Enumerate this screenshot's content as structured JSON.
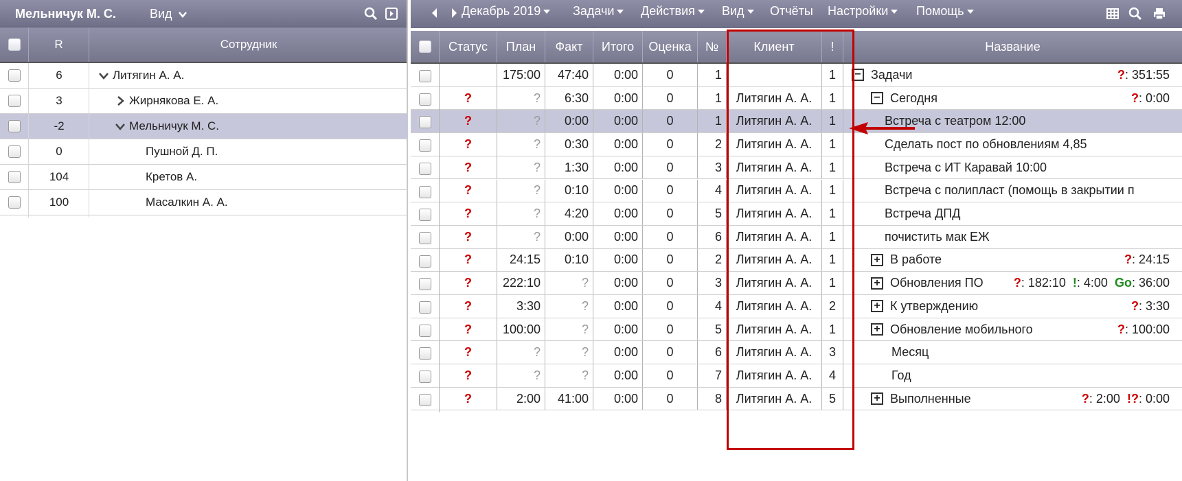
{
  "left_panel": {
    "title": "Мельничук М. С.",
    "view_menu": "Вид",
    "columns": {
      "r": "R",
      "employee": "Сотрудник"
    },
    "rows": [
      {
        "r": "6",
        "name": "Литягин А. А.",
        "indent": 0,
        "toggle": "expanded",
        "selected": false
      },
      {
        "r": "3",
        "name": "Жирнякова Е. А.",
        "indent": 1,
        "toggle": "collapsed",
        "selected": false
      },
      {
        "r": "-2",
        "name": "Мельничук М. С.",
        "indent": 1,
        "toggle": "expanded",
        "selected": true
      },
      {
        "r": "0",
        "name": "Пушной Д. П.",
        "indent": 2,
        "toggle": "none",
        "selected": false
      },
      {
        "r": "104",
        "name": "Кретов А.",
        "indent": 2,
        "toggle": "none",
        "selected": false
      },
      {
        "r": "100",
        "name": "Масалкин А. А.",
        "indent": 2,
        "toggle": "none",
        "selected": false
      }
    ]
  },
  "toolbar": {
    "period": "Декабрь 2019",
    "menus": [
      "Задачи",
      "Действия",
      "Вид",
      "Отчёты",
      "Настройки",
      "Помощь"
    ]
  },
  "table": {
    "columns": {
      "status": "Статус",
      "plan": "План",
      "fact": "Факт",
      "total": "Итого",
      "rating": "Оценка",
      "no": "№",
      "client": "Клиент",
      "priority": "!",
      "name": "Название"
    },
    "rows": [
      {
        "status": "",
        "plan": "175:00",
        "fact": "47:40",
        "total": "0:00",
        "rating": "0",
        "no": "1",
        "client": "",
        "priority": "1",
        "name": "Задачи",
        "level": 0,
        "toggle": "minus",
        "summary": [
          {
            "t": "?",
            "c": "red"
          },
          {
            "t": ": 351:55",
            "c": ""
          }
        ],
        "selected": false
      },
      {
        "status": "?",
        "plan": "?",
        "fact": "6:30",
        "total": "0:00",
        "rating": "0",
        "no": "1",
        "client": "Литягин А. А.",
        "priority": "1",
        "name": "Сегодня",
        "level": 1,
        "toggle": "minus",
        "summary": [
          {
            "t": "?",
            "c": "red"
          },
          {
            "t": ": 0:00",
            "c": ""
          }
        ],
        "selected": false
      },
      {
        "status": "?",
        "plan": "?",
        "fact": "0:00",
        "total": "0:00",
        "rating": "0",
        "no": "1",
        "client": "Литягин А. А.",
        "priority": "1",
        "name": "Встреча с театром 12:00",
        "level": 2,
        "toggle": "none",
        "summary": [],
        "selected": true
      },
      {
        "status": "?",
        "plan": "?",
        "fact": "0:30",
        "total": "0:00",
        "rating": "0",
        "no": "2",
        "client": "Литягин А. А.",
        "priority": "1",
        "name": "Сделать пост по обновлениям 4,85",
        "level": 2,
        "toggle": "none",
        "summary": [],
        "selected": false
      },
      {
        "status": "?",
        "plan": "?",
        "fact": "1:30",
        "total": "0:00",
        "rating": "0",
        "no": "3",
        "client": "Литягин А. А.",
        "priority": "1",
        "name": "Встреча с ИТ Каравай 10:00",
        "level": 2,
        "toggle": "none",
        "summary": [],
        "selected": false
      },
      {
        "status": "?",
        "plan": "?",
        "fact": "0:10",
        "total": "0:00",
        "rating": "0",
        "no": "4",
        "client": "Литягин А. А.",
        "priority": "1",
        "name": "Встреча с полипласт (помощь в закрытии п",
        "level": 2,
        "toggle": "none",
        "summary": [],
        "selected": false
      },
      {
        "status": "?",
        "plan": "?",
        "fact": "4:20",
        "total": "0:00",
        "rating": "0",
        "no": "5",
        "client": "Литягин А. А.",
        "priority": "1",
        "name": "Встреча ДПД",
        "level": 2,
        "toggle": "none",
        "summary": [],
        "selected": false
      },
      {
        "status": "?",
        "plan": "?",
        "fact": "0:00",
        "total": "0:00",
        "rating": "0",
        "no": "6",
        "client": "Литягин А. А.",
        "priority": "1",
        "name": "почистить мак ЕЖ",
        "level": 2,
        "toggle": "none",
        "summary": [],
        "selected": false
      },
      {
        "status": "?",
        "plan": "24:15",
        "fact": "0:10",
        "total": "0:00",
        "rating": "0",
        "no": "2",
        "client": "Литягин А. А.",
        "priority": "1",
        "name": "В работе",
        "level": 1,
        "toggle": "plus",
        "summary": [
          {
            "t": "?",
            "c": "red"
          },
          {
            "t": ": 24:15",
            "c": ""
          }
        ],
        "selected": false
      },
      {
        "status": "?",
        "plan": "222:10",
        "fact": "?",
        "total": "0:00",
        "rating": "0",
        "no": "3",
        "client": "Литягин А. А.",
        "priority": "1",
        "name": "Обновления ПО",
        "level": 1,
        "toggle": "plus",
        "summary": [
          {
            "t": "?",
            "c": "red"
          },
          {
            "t": ": 182:10  ",
            "c": ""
          },
          {
            "t": "!",
            "c": "green"
          },
          {
            "t": ": 4:00  ",
            "c": ""
          },
          {
            "t": "Go",
            "c": "green"
          },
          {
            "t": ": 36:00",
            "c": ""
          }
        ],
        "selected": false
      },
      {
        "status": "?",
        "plan": "3:30",
        "fact": "?",
        "total": "0:00",
        "rating": "0",
        "no": "4",
        "client": "Литягин А. А.",
        "priority": "2",
        "name": "К утверждению",
        "level": 1,
        "toggle": "plus",
        "summary": [
          {
            "t": "?",
            "c": "red"
          },
          {
            "t": ": 3:30",
            "c": ""
          }
        ],
        "selected": false
      },
      {
        "status": "?",
        "plan": "100:00",
        "fact": "?",
        "total": "0:00",
        "rating": "0",
        "no": "5",
        "client": "Литягин А. А.",
        "priority": "1",
        "name": "Обновление мобильного",
        "level": 1,
        "toggle": "plus",
        "summary": [
          {
            "t": "?",
            "c": "red"
          },
          {
            "t": ": 100:00",
            "c": ""
          }
        ],
        "selected": false
      },
      {
        "status": "?",
        "plan": "?",
        "fact": "?",
        "total": "0:00",
        "rating": "0",
        "no": "6",
        "client": "Литягин А. А.",
        "priority": "3",
        "name": "Месяц",
        "level": 1,
        "toggle": "none",
        "summary": [],
        "selected": false
      },
      {
        "status": "?",
        "plan": "?",
        "fact": "?",
        "total": "0:00",
        "rating": "0",
        "no": "7",
        "client": "Литягин А. А.",
        "priority": "4",
        "name": "Год",
        "level": 1,
        "toggle": "none",
        "summary": [],
        "selected": false
      },
      {
        "status": "?",
        "plan": "2:00",
        "fact": "41:00",
        "total": "0:00",
        "rating": "0",
        "no": "8",
        "client": "Литягин А. А.",
        "priority": "5",
        "name": "Выполненные",
        "level": 1,
        "toggle": "plus",
        "summary": [
          {
            "t": "?",
            "c": "red"
          },
          {
            "t": ": 2:00  ",
            "c": ""
          },
          {
            "t": "!?",
            "c": "red"
          },
          {
            "t": ": 0:00",
            "c": ""
          }
        ],
        "selected": false
      }
    ]
  },
  "colors": {
    "header_bg": "#7f7f97",
    "selected_row": "#c7c7dc",
    "highlight_frame": "#c20000",
    "question_mark": "#cc0000",
    "green_marker": "#1d8a1d"
  }
}
